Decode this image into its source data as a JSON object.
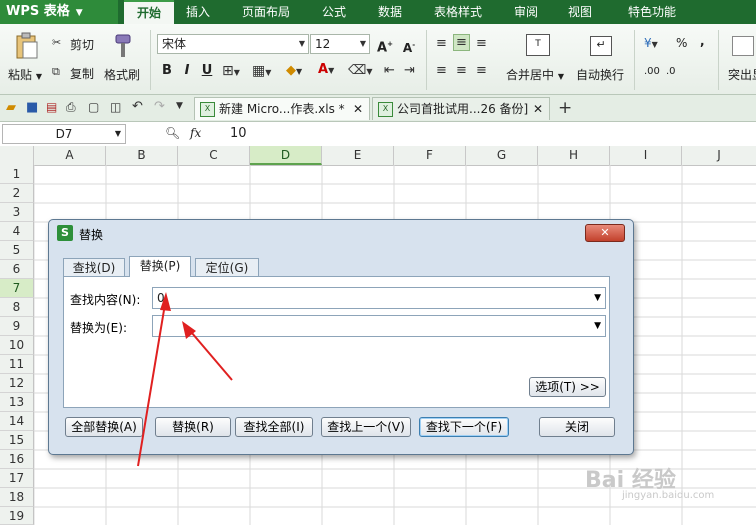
{
  "app": {
    "logo": "WPS 表格"
  },
  "menu": {
    "tabs": [
      "开始",
      "插入",
      "页面布局",
      "公式",
      "数据",
      "表格样式",
      "审阅",
      "视图",
      "特色功能"
    ],
    "active_index": 0
  },
  "ribbon": {
    "paste": "粘贴",
    "cut": "剪切",
    "copy": "复制",
    "format_painter": "格式刷",
    "font_name": "宋体",
    "font_size": "12",
    "bold": "B",
    "italic": "I",
    "underline": "U",
    "merge_center": "合并居中",
    "auto_wrap": "自动换行",
    "percent": "%",
    "comma": ",",
    "inc_decimal": ".00",
    "dec_decimal": ".0",
    "highlight": "突出显"
  },
  "doc_tabs": [
    {
      "label": "新建 Micro...作表.xls *",
      "active": true
    },
    {
      "label": "公司首批试用...26 备份]",
      "active": false
    }
  ],
  "formula_bar": {
    "cell_ref": "D7",
    "fx": "fx",
    "value": "10"
  },
  "grid": {
    "columns": [
      "A",
      "B",
      "C",
      "D",
      "E",
      "F",
      "G",
      "H",
      "I",
      "J"
    ],
    "rows": [
      "1",
      "2",
      "3",
      "4",
      "5",
      "6",
      "7",
      "8",
      "9",
      "10",
      "11",
      "12",
      "13",
      "14",
      "15",
      "16",
      "17",
      "18",
      "19"
    ],
    "selected_col": "D",
    "selected_row": "7"
  },
  "dialog": {
    "title": "替换",
    "tabs": [
      "查找(D)",
      "替换(P)",
      "定位(G)"
    ],
    "active_tab": 1,
    "find_label": "查找内容(N):",
    "find_value": "0",
    "replace_label": "替换为(E):",
    "replace_value": "",
    "options_button": "选项(T) >>",
    "buttons": [
      "全部替换(A)",
      "替换(R)",
      "查找全部(I)",
      "查找上一个(V)",
      "查找下一个(F)",
      "关闭"
    ]
  },
  "colors": {
    "brand_green": "#1f6b2f",
    "selection_green": "#d7ecc7",
    "annotation_red": "#e02020"
  },
  "watermark": {
    "text": "Bai 经验",
    "sub": "jingyan.baidu.com"
  }
}
